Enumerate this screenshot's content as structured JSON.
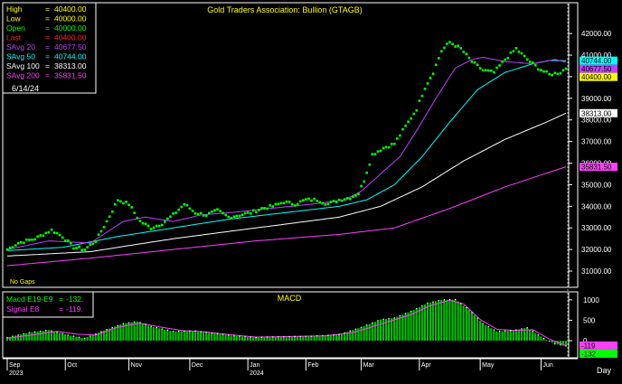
{
  "chart_data": [
    {
      "type": "scatter",
      "title": "Gold Traders Association: Bullion (GTAGB)",
      "ylim": [
        30500,
        42800
      ],
      "yticks": [
        31000,
        32000,
        33000,
        34000,
        35000,
        36000,
        37000,
        38000,
        39000,
        40000,
        41000,
        42000
      ],
      "ytick_labels": [
        "31000.00",
        "32000.00",
        "33000.00",
        "34000.00",
        "35000.00",
        "36000.00",
        "37000.00",
        "38000.00",
        "39000.00",
        "40000.00",
        "41000.00",
        "42000.00"
      ],
      "months": [
        "Sep",
        "Oct",
        "Nov",
        "Dec",
        "Jan",
        "Feb",
        "Mar",
        "Apr",
        "May",
        "Jun"
      ],
      "month_index": [
        0,
        21,
        44,
        66,
        87,
        108,
        128,
        149,
        171,
        193
      ],
      "year_labels": [
        {
          "text": "2023",
          "index": 0
        },
        {
          "text": "2024",
          "index": 87
        }
      ],
      "n": 203,
      "note": "No Gaps",
      "x_axis_label": "Day",
      "legend": [
        {
          "label": "High",
          "value": "40400.00",
          "color": "#ffff00"
        },
        {
          "label": "Low",
          "value": "40000.00",
          "color": "#ffff00"
        },
        {
          "label": "Open",
          "value": "40000.00",
          "color": "#00ff00"
        },
        {
          "label": "Last",
          "value": "40400.00",
          "color": "#ff2020"
        },
        {
          "label": "SAvg 20",
          "value": "40677.50",
          "color": "#c040ff"
        },
        {
          "label": "SAvg 50",
          "value": "40744.00",
          "color": "#00ffff"
        },
        {
          "label": "SAvg 100",
          "value": "38313.00",
          "color": "#ffffff"
        },
        {
          "label": "SAvg 200",
          "value": "35831.50",
          "color": "#ff40ff"
        }
      ],
      "date": "6/14/24",
      "value_tags": [
        {
          "text": "40744.00",
          "value": 40744,
          "bg": "#00ffff",
          "fg": "#000000"
        },
        {
          "text": "40677.50",
          "value": 40677.5,
          "bg": "#c040ff",
          "fg": "#000000"
        },
        {
          "text": "40400.00",
          "value": 40400,
          "bg": "#ffff00",
          "fg": "#000000"
        },
        {
          "text": "38313.00",
          "value": 38313,
          "bg": "#ffffff",
          "fg": "#000000"
        },
        {
          "text": "35831.50",
          "value": 35831.5,
          "bg": "#ff40ff",
          "fg": "#000000"
        }
      ],
      "price_knots": [
        [
          0,
          32000
        ],
        [
          4,
          32300
        ],
        [
          10,
          32500
        ],
        [
          16,
          32900
        ],
        [
          20,
          32600
        ],
        [
          24,
          32100
        ],
        [
          28,
          32000
        ],
        [
          32,
          32400
        ],
        [
          36,
          33300
        ],
        [
          40,
          34300
        ],
        [
          44,
          34100
        ],
        [
          48,
          33300
        ],
        [
          52,
          33000
        ],
        [
          56,
          33200
        ],
        [
          60,
          33600
        ],
        [
          64,
          34100
        ],
        [
          68,
          33700
        ],
        [
          72,
          33600
        ],
        [
          76,
          33800
        ],
        [
          80,
          33500
        ],
        [
          84,
          33600
        ],
        [
          88,
          33700
        ],
        [
          92,
          33900
        ],
        [
          96,
          34000
        ],
        [
          100,
          34200
        ],
        [
          104,
          34100
        ],
        [
          108,
          34300
        ],
        [
          112,
          34300
        ],
        [
          116,
          34100
        ],
        [
          120,
          34300
        ],
        [
          124,
          34400
        ],
        [
          127,
          34600
        ],
        [
          129,
          35200
        ],
        [
          132,
          36400
        ],
        [
          136,
          36700
        ],
        [
          140,
          36900
        ],
        [
          144,
          37700
        ],
        [
          148,
          38500
        ],
        [
          151,
          39500
        ],
        [
          154,
          40200
        ],
        [
          157,
          41200
        ],
        [
          160,
          41600
        ],
        [
          164,
          41300
        ],
        [
          168,
          40700
        ],
        [
          172,
          40300
        ],
        [
          176,
          40200
        ],
        [
          180,
          40800
        ],
        [
          184,
          41300
        ],
        [
          188,
          40800
        ],
        [
          192,
          40400
        ],
        [
          196,
          40100
        ],
        [
          200,
          40200
        ],
        [
          202,
          40400
        ]
      ],
      "sma20_knots": [
        [
          0,
          32000
        ],
        [
          15,
          32400
        ],
        [
          30,
          32300
        ],
        [
          42,
          33300
        ],
        [
          50,
          33500
        ],
        [
          60,
          33300
        ],
        [
          70,
          33600
        ],
        [
          80,
          33700
        ],
        [
          95,
          33900
        ],
        [
          110,
          34100
        ],
        [
          122,
          34300
        ],
        [
          128,
          34700
        ],
        [
          135,
          35500
        ],
        [
          142,
          36300
        ],
        [
          148,
          37500
        ],
        [
          155,
          39000
        ],
        [
          162,
          40400
        ],
        [
          168,
          40800
        ],
        [
          172,
          40900
        ],
        [
          180,
          40700
        ],
        [
          190,
          40600
        ],
        [
          198,
          40800
        ],
        [
          202,
          40677.5
        ]
      ],
      "sma50_knots": [
        [
          0,
          31950
        ],
        [
          20,
          32100
        ],
        [
          40,
          32600
        ],
        [
          60,
          33000
        ],
        [
          80,
          33400
        ],
        [
          100,
          33700
        ],
        [
          120,
          34000
        ],
        [
          130,
          34300
        ],
        [
          140,
          35000
        ],
        [
          150,
          36300
        ],
        [
          160,
          37900
        ],
        [
          170,
          39400
        ],
        [
          180,
          40200
        ],
        [
          190,
          40600
        ],
        [
          196,
          40750
        ],
        [
          202,
          40744
        ]
      ],
      "sma100_knots": [
        [
          0,
          31700
        ],
        [
          30,
          31900
        ],
        [
          60,
          32500
        ],
        [
          90,
          33000
        ],
        [
          120,
          33500
        ],
        [
          135,
          34000
        ],
        [
          150,
          34900
        ],
        [
          165,
          36100
        ],
        [
          180,
          37100
        ],
        [
          195,
          37900
        ],
        [
          202,
          38313
        ]
      ],
      "sma200_knots": [
        [
          0,
          31250
        ],
        [
          30,
          31600
        ],
        [
          60,
          32000
        ],
        [
          90,
          32400
        ],
        [
          120,
          32700
        ],
        [
          140,
          33000
        ],
        [
          160,
          33900
        ],
        [
          180,
          34900
        ],
        [
          202,
          35831.5
        ]
      ]
    },
    {
      "type": "area",
      "title": "MACD",
      "ylim": [
        -330,
        1130
      ],
      "yticks": [
        0,
        500,
        1000
      ],
      "ytick_labels": [
        "0",
        "500",
        "1000"
      ],
      "legend": [
        {
          "label": "Macd  E19-E9",
          "value": "-132.",
          "color": "#00ff00"
        },
        {
          "label": "Signal  E8",
          "value": "-119.",
          "color": "#ff40ff"
        }
      ],
      "value_tags": [
        {
          "text": "-119",
          "value": -119,
          "bg": "#ff40ff",
          "fg": "#000000"
        },
        {
          "text": "-132",
          "value": -132,
          "bg": "#00ff00",
          "fg": "#000000"
        }
      ],
      "macd_knots": [
        [
          0,
          80
        ],
        [
          8,
          200
        ],
        [
          15,
          260
        ],
        [
          22,
          140
        ],
        [
          28,
          60
        ],
        [
          35,
          250
        ],
        [
          42,
          420
        ],
        [
          47,
          470
        ],
        [
          52,
          350
        ],
        [
          60,
          230
        ],
        [
          68,
          240
        ],
        [
          75,
          180
        ],
        [
          82,
          120
        ],
        [
          90,
          80
        ],
        [
          100,
          100
        ],
        [
          110,
          110
        ],
        [
          120,
          150
        ],
        [
          128,
          330
        ],
        [
          135,
          520
        ],
        [
          140,
          560
        ],
        [
          146,
          720
        ],
        [
          152,
          920
        ],
        [
          157,
          1000
        ],
        [
          162,
          1010
        ],
        [
          167,
          760
        ],
        [
          172,
          420
        ],
        [
          177,
          230
        ],
        [
          183,
          250
        ],
        [
          188,
          320
        ],
        [
          194,
          60
        ],
        [
          198,
          -80
        ],
        [
          202,
          -132
        ]
      ],
      "signal_knots": [
        [
          0,
          60
        ],
        [
          10,
          150
        ],
        [
          18,
          230
        ],
        [
          25,
          160
        ],
        [
          32,
          140
        ],
        [
          40,
          330
        ],
        [
          48,
          430
        ],
        [
          55,
          340
        ],
        [
          63,
          250
        ],
        [
          71,
          220
        ],
        [
          80,
          150
        ],
        [
          90,
          90
        ],
        [
          100,
          100
        ],
        [
          115,
          120
        ],
        [
          125,
          200
        ],
        [
          130,
          300
        ],
        [
          138,
          470
        ],
        [
          146,
          640
        ],
        [
          153,
          860
        ],
        [
          160,
          990
        ],
        [
          165,
          900
        ],
        [
          171,
          520
        ],
        [
          177,
          280
        ],
        [
          184,
          250
        ],
        [
          190,
          270
        ],
        [
          196,
          40
        ],
        [
          202,
          -119
        ]
      ]
    }
  ]
}
